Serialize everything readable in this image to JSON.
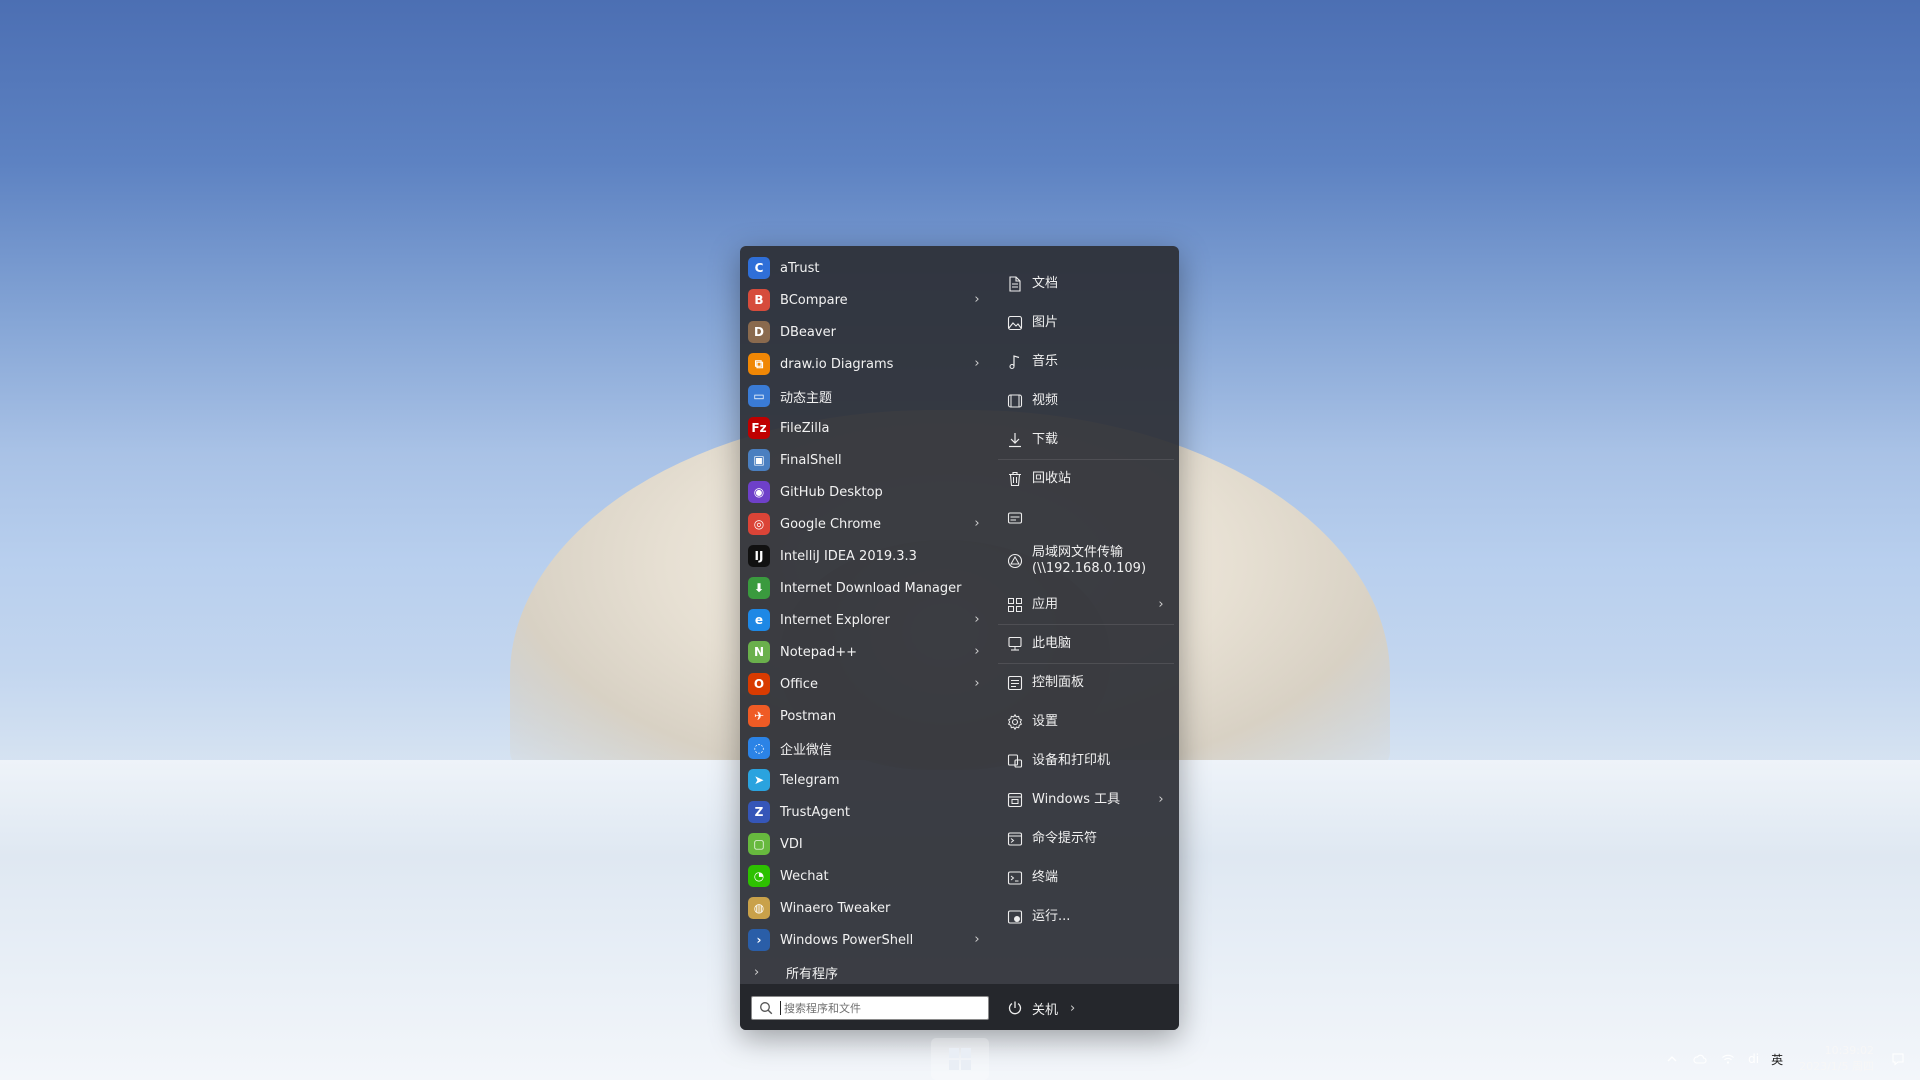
{
  "apps": [
    {
      "label": "aTrust",
      "icon": "atrust-icon",
      "has_submenu": false,
      "color": "#2f6fd8",
      "glyph": "C"
    },
    {
      "label": "BCompare",
      "icon": "bcompare-icon",
      "has_submenu": true,
      "color": "#d64c3c",
      "glyph": "B"
    },
    {
      "label": "DBeaver",
      "icon": "dbeaver-icon",
      "has_submenu": false,
      "color": "#8a6a4e",
      "glyph": "D"
    },
    {
      "label": "draw.io Diagrams",
      "icon": "drawio-icon",
      "has_submenu": true,
      "color": "#f08705",
      "glyph": "⧉"
    },
    {
      "label": "动态主题",
      "icon": "dynamic-theme-icon",
      "has_submenu": false,
      "color": "#3a7bd5",
      "glyph": "▭"
    },
    {
      "label": "FileZilla",
      "icon": "filezilla-icon",
      "has_submenu": false,
      "color": "#bf0000",
      "glyph": "Fz"
    },
    {
      "label": "FinalShell",
      "icon": "finalshell-icon",
      "has_submenu": false,
      "color": "#4a7fc0",
      "glyph": "▣"
    },
    {
      "label": "GitHub Desktop",
      "icon": "github-desktop-icon",
      "has_submenu": false,
      "color": "#6e40c9",
      "glyph": "◉"
    },
    {
      "label": "Google Chrome",
      "icon": "chrome-icon",
      "has_submenu": true,
      "color": "#db4437",
      "glyph": "◎"
    },
    {
      "label": "IntelliJ IDEA 2019.3.3",
      "icon": "intellij-icon",
      "has_submenu": false,
      "color": "#111111",
      "glyph": "IJ"
    },
    {
      "label": "Internet Download Manager",
      "icon": "idm-icon",
      "has_submenu": false,
      "color": "#3a9a3e",
      "glyph": "⬇"
    },
    {
      "label": "Internet Explorer",
      "icon": "ie-icon",
      "has_submenu": true,
      "color": "#1e88e5",
      "glyph": "e"
    },
    {
      "label": "Notepad++",
      "icon": "notepadpp-icon",
      "has_submenu": true,
      "color": "#6ab04c",
      "glyph": "N"
    },
    {
      "label": "Office",
      "icon": "office-icon",
      "has_submenu": true,
      "color": "#d83b01",
      "glyph": "O"
    },
    {
      "label": "Postman",
      "icon": "postman-icon",
      "has_submenu": false,
      "color": "#ef5b25",
      "glyph": "✈"
    },
    {
      "label": "企业微信",
      "icon": "wecom-icon",
      "has_submenu": false,
      "color": "#2b83e6",
      "glyph": "◌"
    },
    {
      "label": "Telegram",
      "icon": "telegram-icon",
      "has_submenu": false,
      "color": "#2aa3df",
      "glyph": "➤"
    },
    {
      "label": "TrustAgent",
      "icon": "trustagent-icon",
      "has_submenu": false,
      "color": "#3556b8",
      "glyph": "Z"
    },
    {
      "label": "VDI",
      "icon": "vdi-icon",
      "has_submenu": false,
      "color": "#67b93e",
      "glyph": "▢"
    },
    {
      "label": "Wechat",
      "icon": "wechat-icon",
      "has_submenu": false,
      "color": "#2dc100",
      "glyph": "◔"
    },
    {
      "label": "Winaero Tweaker",
      "icon": "winaero-tweaker-icon",
      "has_submenu": false,
      "color": "#c9a14a",
      "glyph": "◍"
    },
    {
      "label": "Windows PowerShell",
      "icon": "powershell-icon",
      "has_submenu": true,
      "color": "#2a5ea8",
      "glyph": "›"
    }
  ],
  "all_programs_label": "所有程序",
  "places": [
    {
      "label": "文档",
      "icon": "document-icon",
      "has_submenu": false
    },
    {
      "label": "图片",
      "icon": "pictures-icon",
      "has_submenu": false
    },
    {
      "label": "音乐",
      "icon": "music-icon",
      "has_submenu": false
    },
    {
      "label": "视频",
      "icon": "video-icon",
      "has_submenu": false
    },
    {
      "label": "下载",
      "icon": "download-icon",
      "has_submenu": false
    },
    {
      "label": "回收站",
      "icon": "recycle-bin-icon",
      "has_submenu": false
    },
    {
      "label": "",
      "icon": "drive-icon",
      "has_submenu": false
    },
    {
      "label": "局域网文件传输\n(\\\\192.168.0.109)",
      "icon": "network-share-icon",
      "has_submenu": false
    },
    {
      "label": "应用",
      "icon": "apps-grid-icon",
      "has_submenu": true
    },
    {
      "label": "此电脑",
      "icon": "this-pc-icon",
      "has_submenu": false
    },
    {
      "label": "控制面板",
      "icon": "control-panel-icon",
      "has_submenu": false
    },
    {
      "label": "设置",
      "icon": "settings-gear-icon",
      "has_submenu": false
    },
    {
      "label": "设备和打印机",
      "icon": "devices-printers-icon",
      "has_submenu": false
    },
    {
      "label": "Windows 工具",
      "icon": "windows-tools-icon",
      "has_submenu": true
    },
    {
      "label": "命令提示符",
      "icon": "command-prompt-icon",
      "has_submenu": false
    },
    {
      "label": "终端",
      "icon": "terminal-icon",
      "has_submenu": false
    },
    {
      "label": "运行...",
      "icon": "run-icon",
      "has_submenu": false
    }
  ],
  "search": {
    "placeholder": "搜索程序和文件",
    "value": ""
  },
  "power": {
    "label": "关机"
  },
  "tray": {
    "ime": "英",
    "network_user": "di",
    "time": "10:39:02",
    "date": "2023/1/5 周四"
  }
}
